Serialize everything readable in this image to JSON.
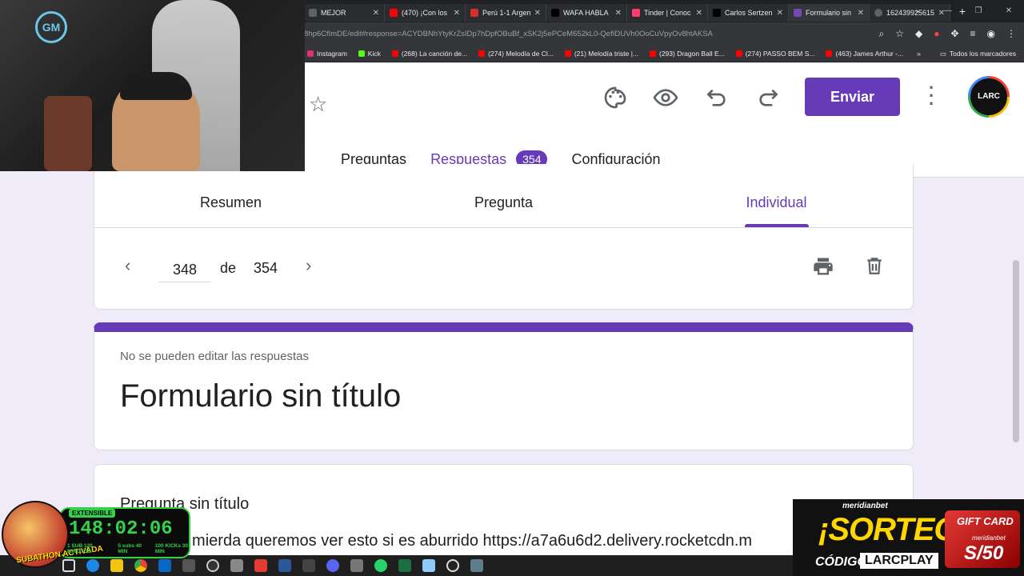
{
  "browser": {
    "tabs": [
      {
        "label": "MEJOR",
        "color": "#5f6368"
      },
      {
        "label": "(470) ¡Con los",
        "color": "#ff0000"
      },
      {
        "label": "Perú 1-1 Argen",
        "color": "#d32f2f"
      },
      {
        "label": "WAFA HABLA",
        "color": "#000000"
      },
      {
        "label": "Tinder | Conoc",
        "color": "#fe3c72"
      },
      {
        "label": "Carlos Sertzen",
        "color": "#000000"
      },
      {
        "label": "Formulario sin",
        "color": "#7248b9"
      },
      {
        "label": "162439925615",
        "color": "#5f6368"
      }
    ],
    "url": "8hp6CfImDE/edit#response=ACYDBNhYtyKrZsIDp7hDpfOBuBf_xSK2j5ePCeM652kL0-QefIDUVh0OoCuVpyOv8htAKSA",
    "bookmarks": [
      {
        "label": "Instagram",
        "color": "#e1306c"
      },
      {
        "label": "Kick",
        "color": "#53fc18"
      },
      {
        "label": "(268) La canción de...",
        "color": "#ff0000"
      },
      {
        "label": "(274) Melodía de Cl...",
        "color": "#ff0000"
      },
      {
        "label": "(21) Melodía triste |...",
        "color": "#ff0000"
      },
      {
        "label": "(293) Dragon Ball E...",
        "color": "#ff0000"
      },
      {
        "label": "(274) PASSO BEM S...",
        "color": "#ff0000"
      },
      {
        "label": "(463) James Arthur -...",
        "color": "#ff0000"
      }
    ],
    "bookmarks_more": "»",
    "all_bookmarks": "Todos los marcadores"
  },
  "form_header": {
    "send_label": "Enviar",
    "avatar_text": "LARC PLAY",
    "tabs": {
      "questions": "Preguntas",
      "responses": "Respuestas",
      "responses_count": "354",
      "settings": "Configuración"
    }
  },
  "responses": {
    "subtabs": {
      "summary": "Resumen",
      "question": "Pregunta",
      "individual": "Individual"
    },
    "pager": {
      "current": "348",
      "of_label": "de",
      "total": "354"
    }
  },
  "form": {
    "notice": "No se pueden editar las respuestas",
    "title": "Formulario sin título"
  },
  "question": {
    "title": "Pregunta sin título",
    "answer": "...ara que mierda queremos ver esto si es aburrido https://a7a6u6d2.delivery.rocketcdn.m"
  },
  "overlays": {
    "timer": {
      "badge": "EXTENSIBLE",
      "time": "148:02:06",
      "goal1": "1 SUB 120 MINUTOS",
      "goal2": "5 subs 40 MIN",
      "goal3": "100 KICKs 30 MIN",
      "mascot_text": "SUBATHON ACTIVADA"
    },
    "promo": {
      "brand": "meridianbet",
      "headline": "¡SORTEO!",
      "code_label": "CÓDIGO:",
      "code": "LARCPLAY",
      "gift_label": "GIFT CARD",
      "gift_brand": "meridianbet",
      "gift_value": "S/50"
    }
  },
  "colors": {
    "accent": "#673ab7",
    "background": "#f0ebf8"
  }
}
